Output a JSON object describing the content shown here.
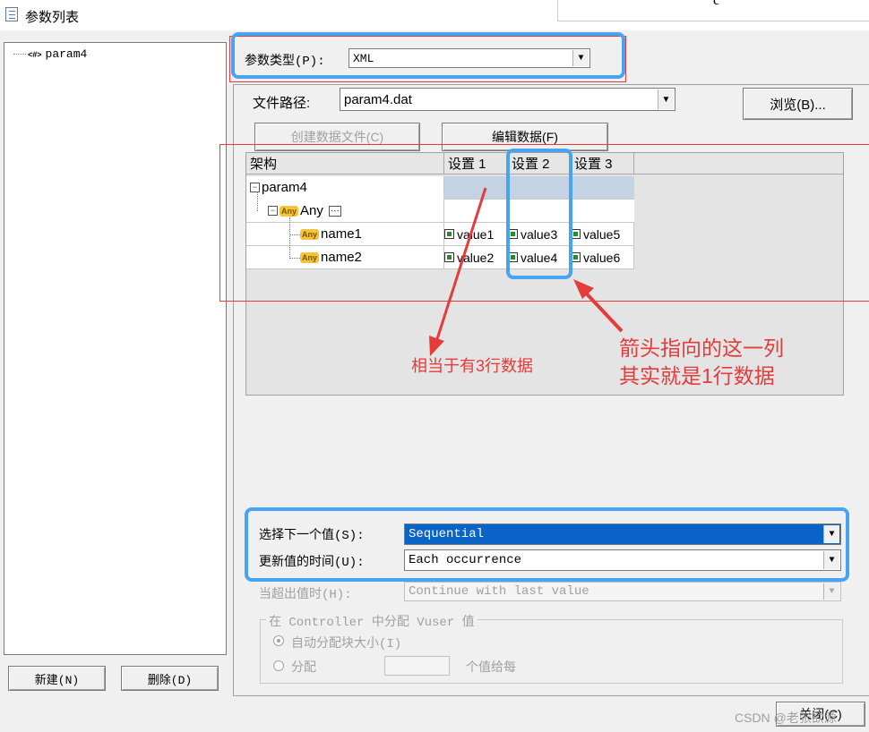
{
  "window": {
    "title": "参数列表",
    "top_right_fragment": "c"
  },
  "tree": {
    "items": [
      {
        "label": "param4"
      }
    ]
  },
  "left_buttons": {
    "new_label": "新建(N)",
    "delete_label": "删除(D)"
  },
  "param_type": {
    "label": "参数类型(P):",
    "value": "XML"
  },
  "file_path": {
    "label": "文件路径:",
    "value": "param4.dat",
    "browse_label": "浏览(B)..."
  },
  "actions": {
    "create_label": "创建数据文件(C)",
    "edit_label": "编辑数据(F)"
  },
  "grid": {
    "headers": [
      "架构",
      "设置 1",
      "设置 2",
      "设置 3"
    ],
    "root": "param4",
    "any_node": "Any",
    "rows": [
      {
        "name": "name1",
        "values": [
          "value1",
          "value3",
          "value5"
        ]
      },
      {
        "name": "name2",
        "values": [
          "value2",
          "value4",
          "value6"
        ]
      }
    ]
  },
  "annotations": {
    "left_note": "相当于有3行数据",
    "right_note_line1": "箭头指向的这一列",
    "right_note_line2": "其实就是1行数据"
  },
  "select_next": {
    "label": "选择下一个值(S):",
    "value": "Sequential"
  },
  "update_value": {
    "label": "更新值的时间(U):",
    "value": "Each occurrence"
  },
  "when_out": {
    "label": "当超出值时(H):",
    "value": "Continue with last value"
  },
  "controller": {
    "legend": "在 Controller 中分配 Vuser 值",
    "auto_label": "自动分配块大小(I)",
    "alloc_label": "分配",
    "alloc_suffix": "个值给每"
  },
  "close_label": "关闭(C)",
  "watermark": "CSDN @老张欲源",
  "colors": {
    "highlight_blue": "#47a3f3",
    "annotation_red": "#e53b3b",
    "selection": "#0a64c8"
  }
}
